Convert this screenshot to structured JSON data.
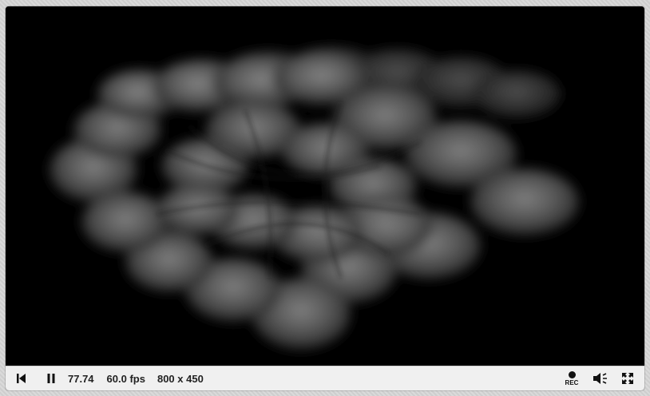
{
  "controls": {
    "time": "77.74",
    "fps": "60.0 fps",
    "resolution": "800 x 450",
    "rec_label": "REC"
  },
  "icons": {
    "rewind": "skip-to-start-icon",
    "pause": "pause-icon",
    "record": "record-icon",
    "volume": "volume-icon",
    "fullscreen": "fullscreen-icon"
  },
  "colors": {
    "canvas_background": "#000000",
    "controls_background": "#f0f0f0",
    "page_background": "#d6d6d6"
  }
}
